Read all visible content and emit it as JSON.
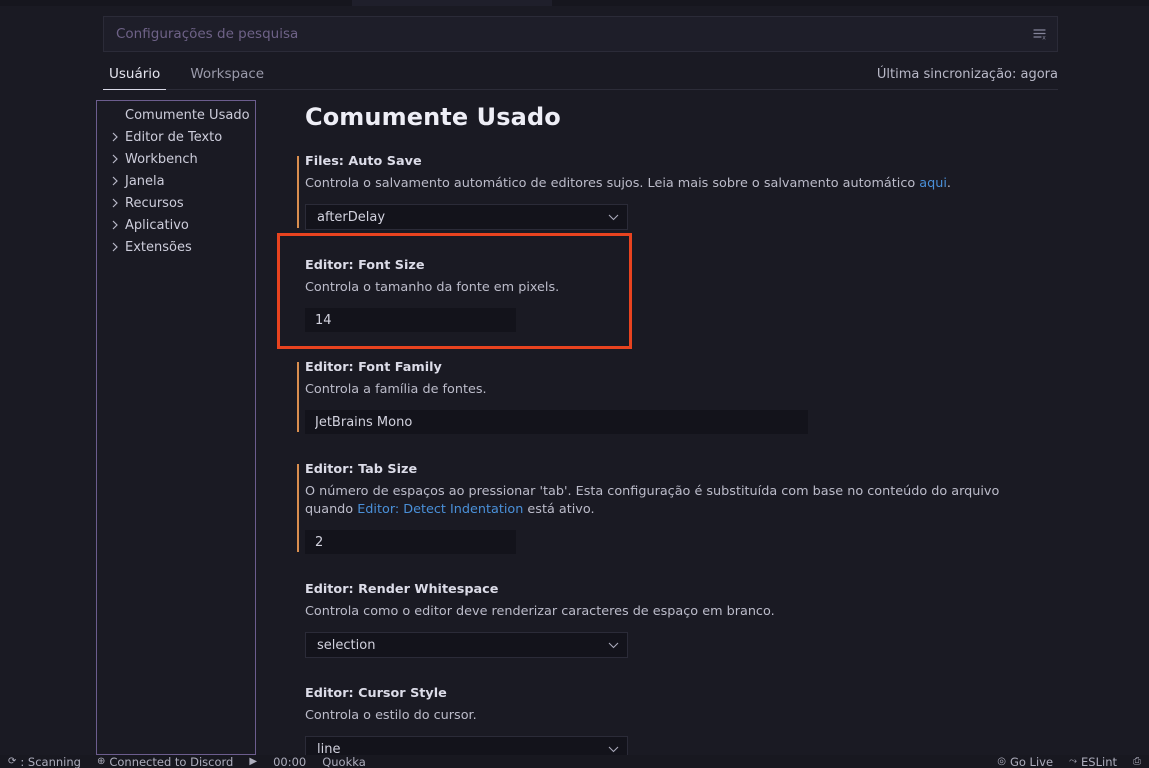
{
  "search": {
    "placeholder": "Configurações de pesquisa",
    "value": "",
    "filter_icon": "filter-clear-icon"
  },
  "tabs": [
    {
      "label": "Usuário",
      "active": true
    },
    {
      "label": "Workspace",
      "active": false
    }
  ],
  "sync_status": "Última sincronização: agora",
  "toc": {
    "items": [
      {
        "label": "Comumente Usado",
        "expandable": false,
        "selected": true
      },
      {
        "label": "Editor de Texto",
        "expandable": true,
        "selected": false
      },
      {
        "label": "Workbench",
        "expandable": true,
        "selected": false
      },
      {
        "label": "Janela",
        "expandable": true,
        "selected": false
      },
      {
        "label": "Recursos",
        "expandable": true,
        "selected": false
      },
      {
        "label": "Aplicativo",
        "expandable": true,
        "selected": false
      },
      {
        "label": "Extensões",
        "expandable": true,
        "selected": false
      }
    ]
  },
  "page_title": "Comumente Usado",
  "settings": [
    {
      "title": "Files: Auto Save",
      "desc_before": "Controla o salvamento automático de editores sujos. Leia mais sobre o salvamento automático ",
      "link_text": "aqui",
      "desc_after": ".",
      "control": "select",
      "value": "afterDelay",
      "modified": true
    },
    {
      "title": "Editor: Font Size",
      "desc_before": "Controla o tamanho da fonte em pixels.",
      "link_text": "",
      "desc_after": "",
      "control": "text-narrow",
      "value": "14",
      "modified": false
    },
    {
      "title": "Editor: Font Family",
      "desc_before": "Controla a família de fontes.",
      "link_text": "",
      "desc_after": "",
      "control": "text-wide",
      "value": "JetBrains Mono",
      "modified": true
    },
    {
      "title": "Editor: Tab Size",
      "desc_before": "O número de espaços ao pressionar 'tab'. Esta configuração é substituída com base no conteúdo do arquivo quando ",
      "link_text": "Editor: Detect Indentation",
      "desc_after": " está ativo.",
      "control": "text-narrow",
      "value": "2",
      "modified": true
    },
    {
      "title": "Editor: Render Whitespace",
      "desc_before": "Controla como o editor deve renderizar caracteres de espaço em branco.",
      "link_text": "",
      "desc_after": "",
      "control": "select",
      "value": "selection",
      "modified": false
    },
    {
      "title": "Editor: Cursor Style",
      "desc_before": "Controla o estilo do cursor.",
      "link_text": "",
      "desc_after": "",
      "control": "select",
      "value": "line",
      "modified": false
    }
  ],
  "highlight": {
    "color": "#e8431f",
    "targets_setting": "Editor: Font Size"
  },
  "statusbar": {
    "left": [
      {
        "icon": "sync-icon",
        "glyph": "⟳",
        "label": ": Scanning"
      },
      {
        "icon": "globe-icon",
        "glyph": "⊕",
        "label": "Connected to Discord"
      },
      {
        "icon": "play-icon",
        "glyph": "▶",
        "label": ""
      },
      {
        "icon": "",
        "glyph": "",
        "label": "00:00"
      },
      {
        "icon": "",
        "glyph": "",
        "label": "Quokka"
      }
    ],
    "right": [
      {
        "icon": "broadcast-icon",
        "glyph": "◎",
        "label": "Go Live"
      },
      {
        "icon": "eslint-icon",
        "glyph": "⤳",
        "label": "ESLint"
      },
      {
        "icon": "bell-icon",
        "glyph": "⎙",
        "label": ""
      }
    ]
  },
  "colors": {
    "background": "#1a1a23",
    "accent_modified": "#d98e4f",
    "link": "#4a90d9",
    "highlight": "#e8431f",
    "toc_border": "#6c5d8e"
  }
}
